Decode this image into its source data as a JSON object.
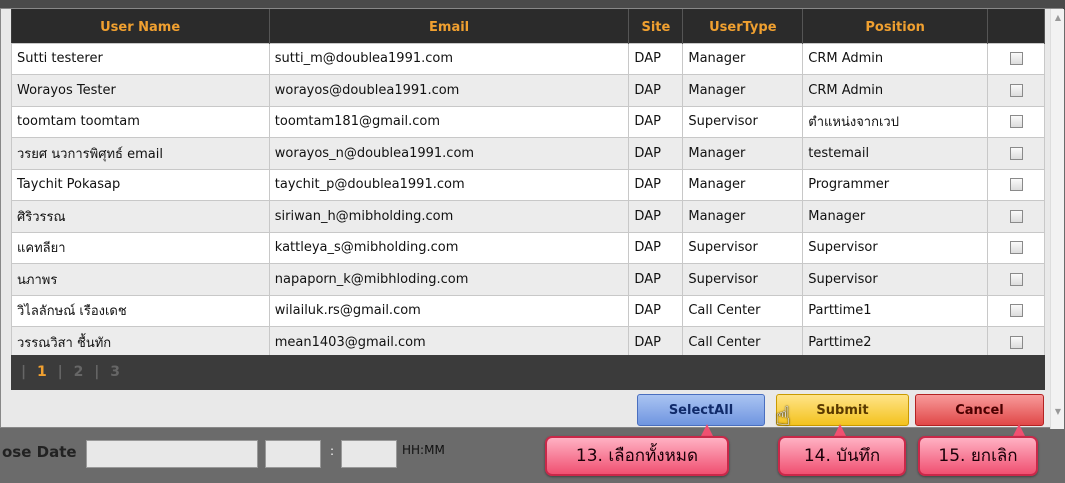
{
  "table": {
    "headers": [
      "User Name",
      "Email",
      "Site",
      "UserType",
      "Position",
      ""
    ],
    "rows": [
      {
        "name": "Sutti testerer",
        "email": "sutti_m@doublea1991.com",
        "site": "DAP",
        "type": "Manager",
        "position": "CRM Admin"
      },
      {
        "name": "Worayos Tester",
        "email": "worayos@doublea1991.com",
        "site": "DAP",
        "type": "Manager",
        "position": "CRM Admin"
      },
      {
        "name": "toomtam toomtam",
        "email": "toomtam181@gmail.com",
        "site": "DAP",
        "type": "Supervisor",
        "position": "ตำแหน่งจากเวป"
      },
      {
        "name": "วรยศ นวการพิศุทธ์ email",
        "email": "worayos_n@doublea1991.com",
        "site": "DAP",
        "type": "Manager",
        "position": "testemail"
      },
      {
        "name": "Taychit Pokasap",
        "email": "taychit_p@doublea1991.com",
        "site": "DAP",
        "type": "Manager",
        "position": "Programmer"
      },
      {
        "name": "ศิริวรรณ",
        "email": "siriwan_h@mibholding.com",
        "site": "DAP",
        "type": "Manager",
        "position": "Manager"
      },
      {
        "name": "แคทลียา",
        "email": "kattleya_s@mibholding.com",
        "site": "DAP",
        "type": "Supervisor",
        "position": "Supervisor"
      },
      {
        "name": "นภาพร",
        "email": "napaporn_k@mibhloding.com",
        "site": "DAP",
        "type": "Supervisor",
        "position": "Supervisor"
      },
      {
        "name": "วิไลลักษณ์ เรืองเดช",
        "email": "wilailuk.rs@gmail.com",
        "site": "DAP",
        "type": "Call Center",
        "position": "Parttime1"
      },
      {
        "name": "วรรณวิสา ชื้นทัก",
        "email": "mean1403@gmail.com",
        "site": "DAP",
        "type": "Call Center",
        "position": "Parttime2"
      }
    ]
  },
  "pager": {
    "pages": [
      "1",
      "2",
      "3"
    ],
    "active": "1"
  },
  "buttons": {
    "select_all": "SelectAll",
    "submit": "Submit",
    "cancel": "Cancel"
  },
  "callouts": {
    "select_all": "13. เลือกทั้งหมด",
    "submit": "14. บันทึก",
    "cancel": "15. ยกเลิก"
  },
  "background": {
    "label": "ose Date",
    "time_hint": "HH:MM",
    "colon": ":"
  },
  "colors": {
    "header_text": "#f0a030",
    "select_all": "#6f95e0",
    "submit": "#f3c21e",
    "cancel": "#e04848",
    "callout": "#f05071"
  }
}
